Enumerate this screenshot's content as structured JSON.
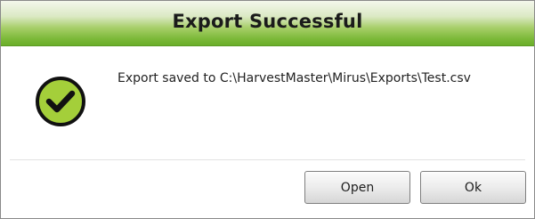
{
  "dialog": {
    "title": "Export Successful",
    "message": "Export saved to C:\\HarvestMaster\\Mirus\\Exports\\Test.csv",
    "icon": "check-circle-icon",
    "buttons": {
      "open_label": "Open",
      "ok_label": "Ok"
    }
  },
  "colors": {
    "title_bar_green": "#7cb939",
    "icon_green": "#a4cf3a",
    "icon_outline": "#111111"
  }
}
